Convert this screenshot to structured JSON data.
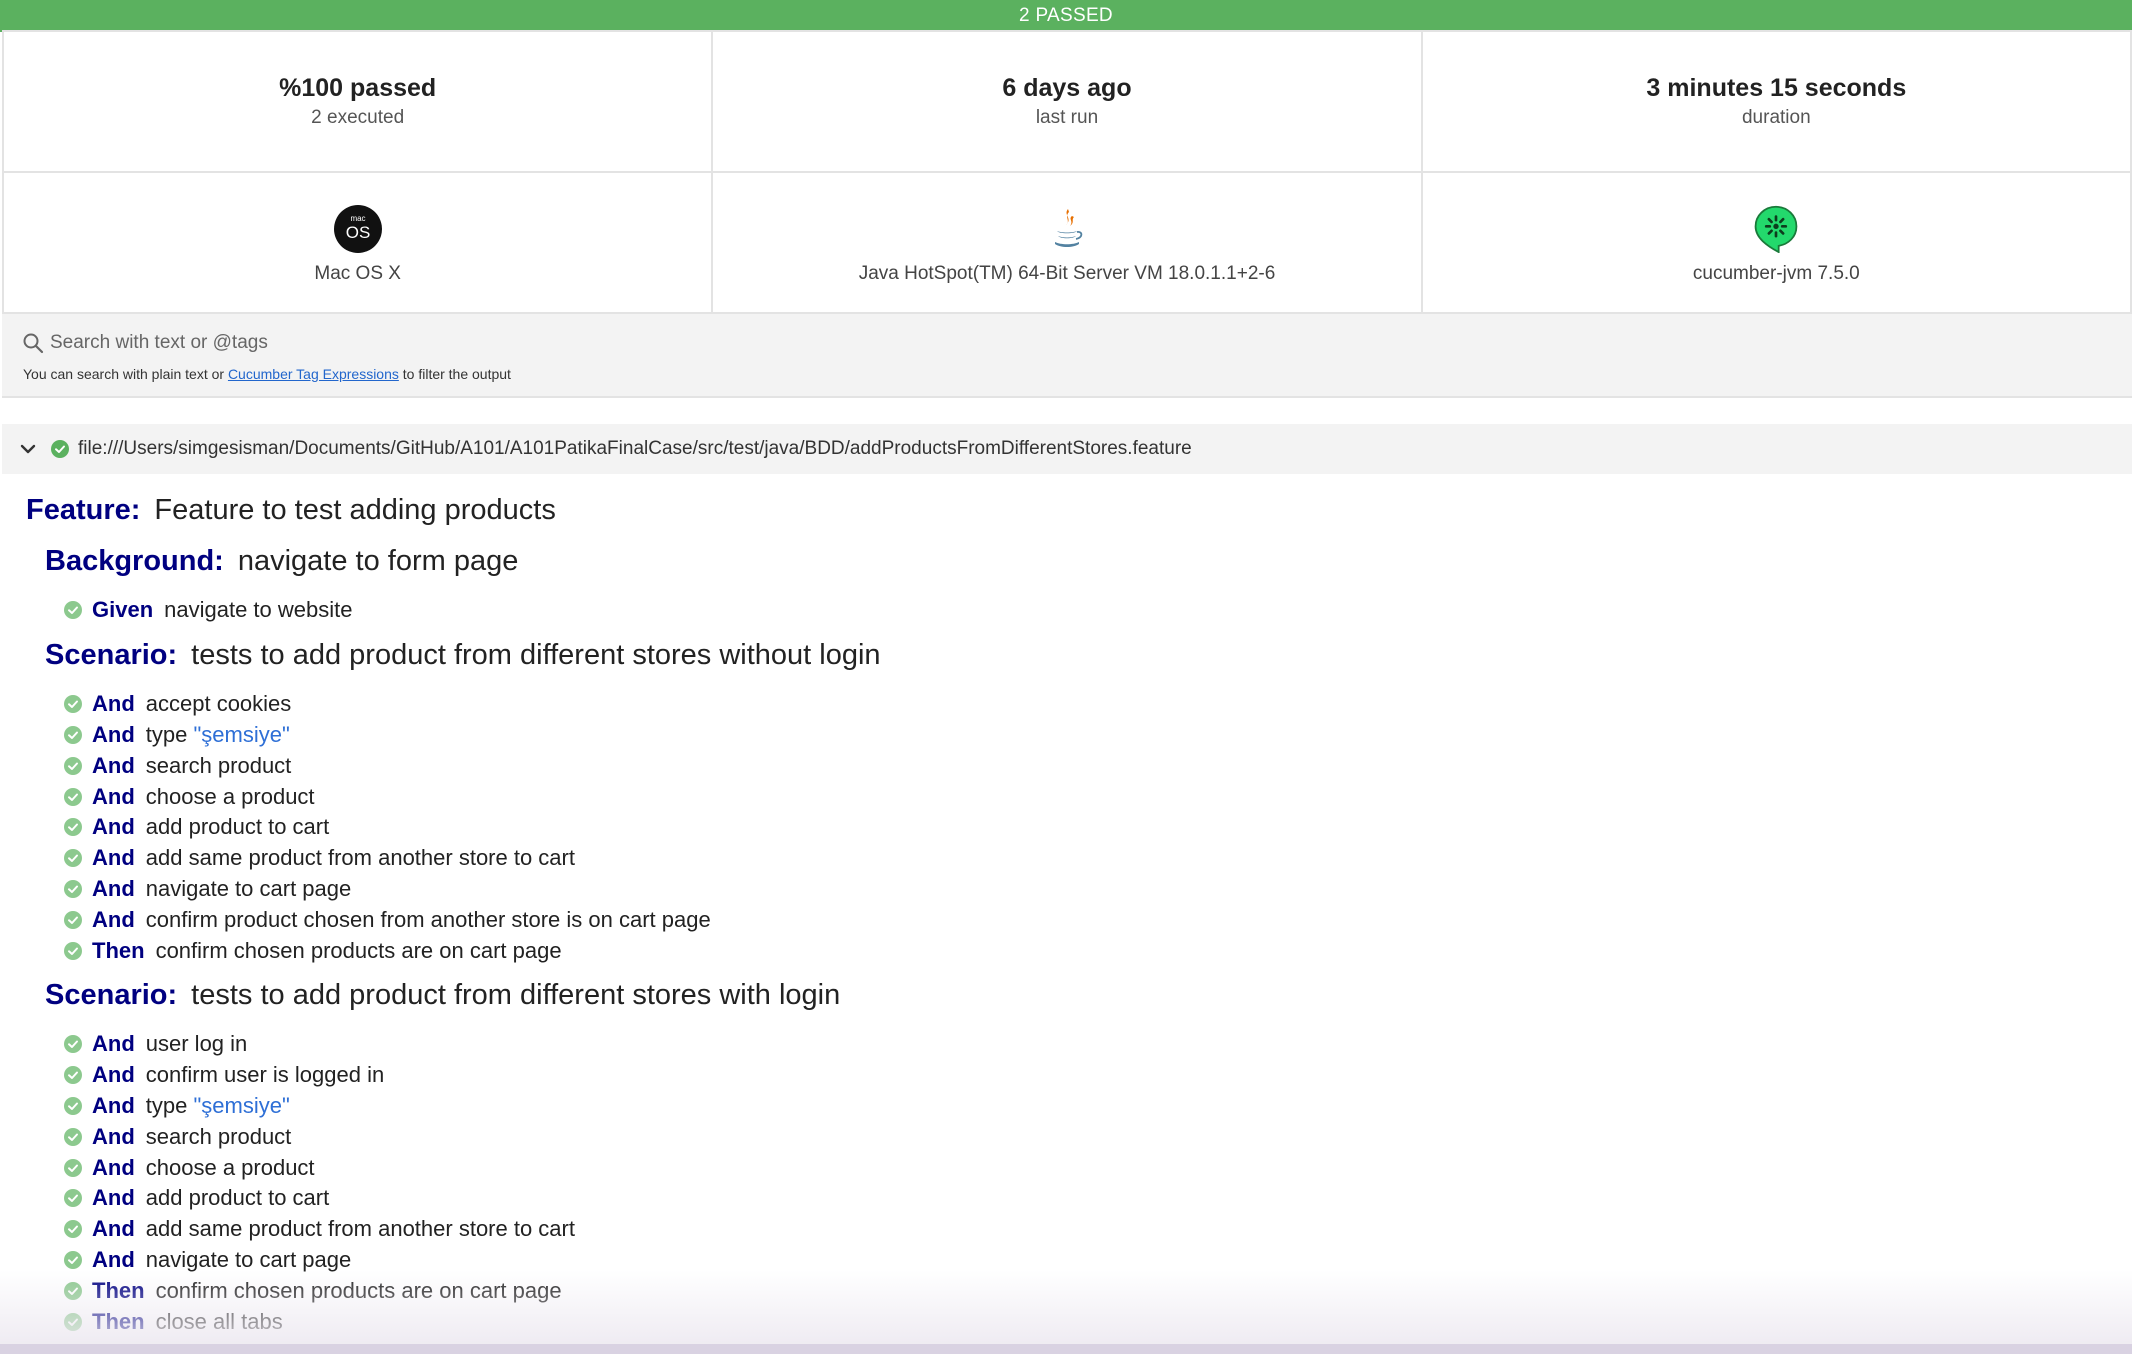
{
  "banner": {
    "text": "2 PASSED",
    "color": "#5bb15f"
  },
  "stats": [
    {
      "main": "%100 passed",
      "sub": "2 executed"
    },
    {
      "main": "6 days ago",
      "sub": "last run"
    },
    {
      "main": "3 minutes 15 seconds",
      "sub": "duration"
    }
  ],
  "environment": [
    {
      "icon": "macos-icon",
      "label": "Mac OS X",
      "icon_text_small": "mac",
      "icon_text_big": "OS"
    },
    {
      "icon": "java-icon",
      "label": "Java HotSpot(TM) 64-Bit Server VM 18.0.1.1+2-6"
    },
    {
      "icon": "cucumber-icon",
      "label": "cucumber-jvm 7.5.0"
    }
  ],
  "search": {
    "placeholder": "Search with text or @tags",
    "help_prefix": "You can search with plain text or ",
    "help_link": "Cucumber Tag Expressions",
    "help_suffix": " to filter the output"
  },
  "feature_file": {
    "path": "file:///Users/simgesisman/Documents/GitHub/A101/A101PatikaFinalCase/src/test/java/BDD/addProductsFromDifferentStores.feature",
    "status": "passed"
  },
  "feature": {
    "keyword": "Feature:",
    "name": "Feature to test adding products",
    "background": {
      "keyword": "Background:",
      "name": "navigate to form page",
      "steps": [
        {
          "keyword": "Given",
          "text": "navigate to website",
          "status": "passed"
        }
      ]
    },
    "scenarios": [
      {
        "keyword": "Scenario:",
        "name": "tests to add product from different stores without login",
        "steps": [
          {
            "keyword": "And",
            "text": "accept cookies",
            "status": "passed"
          },
          {
            "keyword": "And",
            "text": "type ",
            "param": "\"şemsiye\"",
            "status": "passed"
          },
          {
            "keyword": "And",
            "text": "search product",
            "status": "passed"
          },
          {
            "keyword": "And",
            "text": "choose a product",
            "status": "passed"
          },
          {
            "keyword": "And",
            "text": "add product to cart",
            "status": "passed"
          },
          {
            "keyword": "And",
            "text": "add same product from another store to cart",
            "status": "passed"
          },
          {
            "keyword": "And",
            "text": "navigate to cart page",
            "status": "passed"
          },
          {
            "keyword": "And",
            "text": "confirm product chosen from another store is on cart page",
            "status": "passed"
          },
          {
            "keyword": "Then",
            "text": "confirm chosen products are on cart page",
            "status": "passed"
          }
        ]
      },
      {
        "keyword": "Scenario:",
        "name": "tests to add product from different stores with login",
        "steps": [
          {
            "keyword": "And",
            "text": "user log in",
            "status": "passed"
          },
          {
            "keyword": "And",
            "text": "confirm user is logged in",
            "status": "passed"
          },
          {
            "keyword": "And",
            "text": "type ",
            "param": "\"şemsiye\"",
            "status": "passed"
          },
          {
            "keyword": "And",
            "text": "search product",
            "status": "passed"
          },
          {
            "keyword": "And",
            "text": "choose a product",
            "status": "passed"
          },
          {
            "keyword": "And",
            "text": "add product to cart",
            "status": "passed"
          },
          {
            "keyword": "And",
            "text": "add same product from another store to cart",
            "status": "passed"
          },
          {
            "keyword": "And",
            "text": "navigate to cart page",
            "status": "passed"
          },
          {
            "keyword": "Then",
            "text": "confirm chosen products are on cart page",
            "status": "passed"
          },
          {
            "keyword": "Then",
            "text": "close all tabs",
            "status": "passed"
          }
        ]
      }
    ]
  }
}
